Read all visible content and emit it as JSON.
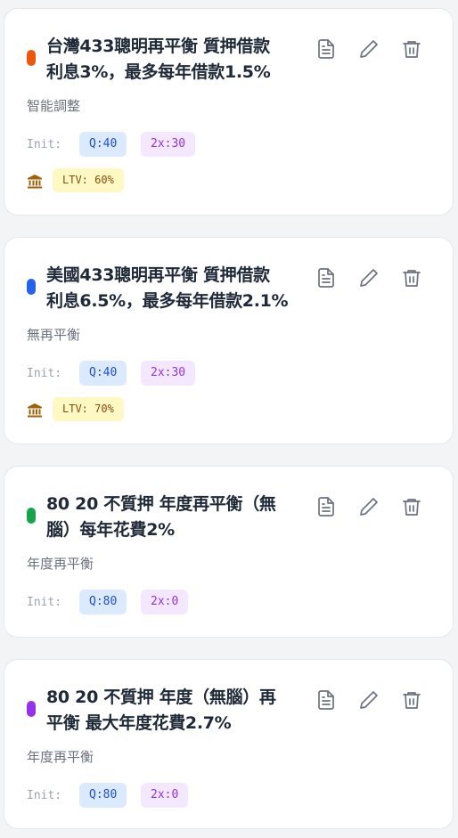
{
  "colors": {
    "orange": "#ea580c",
    "blue": "#2563eb",
    "green": "#16a34a",
    "purple": "#9333ea"
  },
  "cards": [
    {
      "dot_color": "#ea580c",
      "title_line1": "台灣433聰明再平衡 質押借款",
      "title_line2": "利息3%，最多每年借款1.5%",
      "subtitle": "智能調整",
      "init_label": "Init:",
      "q_chip": "Q:40",
      "x2_chip": "2x:30",
      "ltv": "LTV: 60%"
    },
    {
      "dot_color": "#2563eb",
      "title_line1": "美國433聰明再平衡 質押借款",
      "title_line2": "利息6.5%，最多每年借款2.1%",
      "subtitle": "無再平衡",
      "init_label": "Init:",
      "q_chip": "Q:40",
      "x2_chip": "2x:30",
      "ltv": "LTV: 70%"
    },
    {
      "dot_color": "#16a34a",
      "title_line1": "80 20 不質押 年度再平衡（無",
      "title_line2": "腦）每年花費2%",
      "subtitle": "年度再平衡",
      "init_label": "Init:",
      "q_chip": "Q:80",
      "x2_chip": "2x:0"
    },
    {
      "dot_color": "#9333ea",
      "title_line1": "80 20 不質押 年度（無腦）再",
      "title_line2": "平衡 最大年度花費2.7%",
      "subtitle": "年度再平衡",
      "init_label": "Init:",
      "q_chip": "Q:80",
      "x2_chip": "2x:0"
    }
  ],
  "icons": {
    "detail": "document-icon",
    "edit": "pencil-icon",
    "delete": "trash-icon",
    "ltv": "bank-icon"
  }
}
